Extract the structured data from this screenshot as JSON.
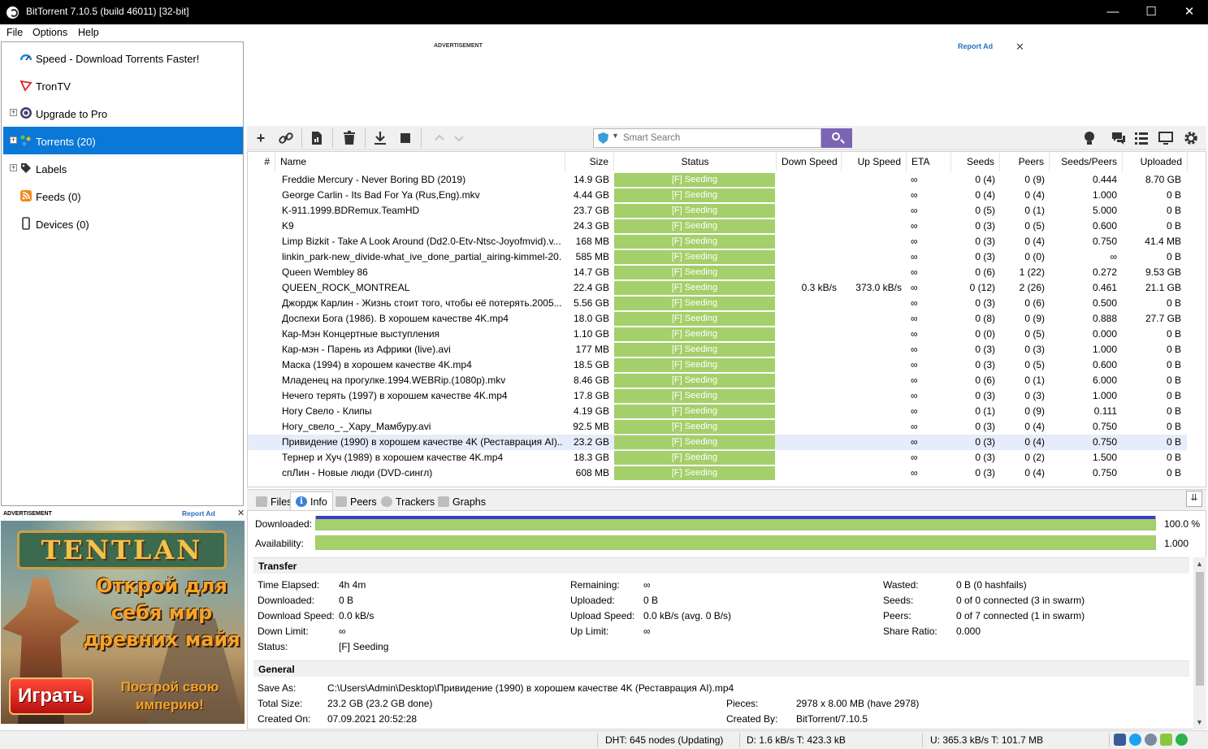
{
  "window": {
    "title": "BitTorrent 7.10.5  (build 46011) [32-bit]",
    "minimize": "—",
    "maximize": "☐",
    "close": "✕"
  },
  "menu": [
    "File",
    "Options",
    "Help"
  ],
  "sidebar": {
    "items": [
      {
        "label": "Speed - Download Torrents Faster!",
        "icon": "speedometer-icon",
        "expander": ""
      },
      {
        "label": "TronTV",
        "icon": "tron-icon",
        "expander": ""
      },
      {
        "label": "Upgrade to Pro",
        "icon": "bittorrent-logo-icon",
        "expander": "+"
      },
      {
        "label": "Torrents (20)",
        "icon": "torrents-icon",
        "expander": "+"
      },
      {
        "label": "Labels",
        "icon": "label-tag-icon",
        "expander": "+"
      },
      {
        "label": "Feeds (0)",
        "icon": "rss-icon",
        "expander": ""
      },
      {
        "label": "Devices (0)",
        "icon": "device-icon",
        "expander": ""
      }
    ]
  },
  "side_ad": {
    "header": "ADVERTISEMENT",
    "report": "Report Ad",
    "close": "✕",
    "logo": "TENTLAN",
    "headline": "Открой для себя мир древних майя",
    "play": "Играть",
    "sub": "Построй свою империю!"
  },
  "top_ad": {
    "header": "ADVERTISEMENT",
    "report": "Report Ad",
    "close": "✕"
  },
  "toolbar": {
    "add": "+",
    "search_placeholder": "Smart Search"
  },
  "table": {
    "columns": [
      "#",
      "Name",
      "Size",
      "Status",
      "Down Speed",
      "Up Speed",
      "ETA",
      "Seeds",
      "Peers",
      "Seeds/Peers",
      "Uploaded"
    ],
    "rows": [
      {
        "name": "Freddie Mercury - Never Boring BD (2019)",
        "size": "14.9 GB",
        "status": "[F] Seeding",
        "down": "",
        "up": "",
        "eta": "∞",
        "seeds": "0 (4)",
        "peers": "0 (9)",
        "ratio": "0.444",
        "uploaded": "8.70 GB"
      },
      {
        "name": "George Carlin - Its Bad For Ya (Rus,Eng).mkv",
        "size": "4.44 GB",
        "status": "[F] Seeding",
        "down": "",
        "up": "",
        "eta": "∞",
        "seeds": "0 (4)",
        "peers": "0 (4)",
        "ratio": "1.000",
        "uploaded": "0 B"
      },
      {
        "name": "K-911.1999.BDRemux.TeamHD",
        "size": "23.7 GB",
        "status": "[F] Seeding",
        "down": "",
        "up": "",
        "eta": "∞",
        "seeds": "0 (5)",
        "peers": "0 (1)",
        "ratio": "5.000",
        "uploaded": "0 B"
      },
      {
        "name": "K9",
        "size": "24.3 GB",
        "status": "[F] Seeding",
        "down": "",
        "up": "",
        "eta": "∞",
        "seeds": "0 (3)",
        "peers": "0 (5)",
        "ratio": "0.600",
        "uploaded": "0 B"
      },
      {
        "name": "Limp Bizkit - Take A Look Around (Dd2.0-Etv-Ntsc-Joyofmvid).v...",
        "size": "168 MB",
        "status": "[F] Seeding",
        "down": "",
        "up": "",
        "eta": "∞",
        "seeds": "0 (3)",
        "peers": "0 (4)",
        "ratio": "0.750",
        "uploaded": "41.4 MB"
      },
      {
        "name": "linkin_park-new_divide-what_ive_done_partial_airing-kimmel-20...",
        "size": "585 MB",
        "status": "[F] Seeding",
        "down": "",
        "up": "",
        "eta": "∞",
        "seeds": "0 (3)",
        "peers": "0 (0)",
        "ratio": "∞",
        "uploaded": "0 B"
      },
      {
        "name": "Queen Wembley 86",
        "size": "14.7 GB",
        "status": "[F] Seeding",
        "down": "",
        "up": "",
        "eta": "∞",
        "seeds": "0 (6)",
        "peers": "1 (22)",
        "ratio": "0.272",
        "uploaded": "9.53 GB"
      },
      {
        "name": "QUEEN_ROCK_MONTREAL",
        "size": "22.4 GB",
        "status": "[F] Seeding",
        "down": "0.3 kB/s",
        "up": "373.0 kB/s",
        "eta": "∞",
        "seeds": "0 (12)",
        "peers": "2 (26)",
        "ratio": "0.461",
        "uploaded": "21.1 GB"
      },
      {
        "name": "Джордж Карлин - Жизнь стоит того, чтобы её потерять.2005....",
        "size": "5.56 GB",
        "status": "[F] Seeding",
        "down": "",
        "up": "",
        "eta": "∞",
        "seeds": "0 (3)",
        "peers": "0 (6)",
        "ratio": "0.500",
        "uploaded": "0 B"
      },
      {
        "name": "Доспехи Бога (1986). В хорошем качестве 4K.mp4",
        "size": "18.0 GB",
        "status": "[F] Seeding",
        "down": "",
        "up": "",
        "eta": "∞",
        "seeds": "0 (8)",
        "peers": "0 (9)",
        "ratio": "0.888",
        "uploaded": "27.7 GB"
      },
      {
        "name": "Кар-Мэн Концертные выступления",
        "size": "1.10 GB",
        "status": "[F] Seeding",
        "down": "",
        "up": "",
        "eta": "∞",
        "seeds": "0 (0)",
        "peers": "0 (5)",
        "ratio": "0.000",
        "uploaded": "0 B"
      },
      {
        "name": "Кар-мэн - Парень из Африки (live).avi",
        "size": "177 MB",
        "status": "[F] Seeding",
        "down": "",
        "up": "",
        "eta": "∞",
        "seeds": "0 (3)",
        "peers": "0 (3)",
        "ratio": "1.000",
        "uploaded": "0 B"
      },
      {
        "name": "Маска (1994) в хорошем качестве 4K.mp4",
        "size": "18.5 GB",
        "status": "[F] Seeding",
        "down": "",
        "up": "",
        "eta": "∞",
        "seeds": "0 (3)",
        "peers": "0 (5)",
        "ratio": "0.600",
        "uploaded": "0 B"
      },
      {
        "name": "Младенец на прогулке.1994.WEBRip.(1080p).mkv",
        "size": "8.46 GB",
        "status": "[F] Seeding",
        "down": "",
        "up": "",
        "eta": "∞",
        "seeds": "0 (6)",
        "peers": "0 (1)",
        "ratio": "6.000",
        "uploaded": "0 B"
      },
      {
        "name": "Нечего терять (1997) в хорошем качестве 4K.mp4",
        "size": "17.8 GB",
        "status": "[F] Seeding",
        "down": "",
        "up": "",
        "eta": "∞",
        "seeds": "0 (3)",
        "peers": "0 (3)",
        "ratio": "1.000",
        "uploaded": "0 B"
      },
      {
        "name": "Ногу Свело - Клипы",
        "size": "4.19 GB",
        "status": "[F] Seeding",
        "down": "",
        "up": "",
        "eta": "∞",
        "seeds": "0 (1)",
        "peers": "0 (9)",
        "ratio": "0.111",
        "uploaded": "0 B"
      },
      {
        "name": "Ногу_свело_-_Хару_Мамбуру.avi",
        "size": "92.5 MB",
        "status": "[F] Seeding",
        "down": "",
        "up": "",
        "eta": "∞",
        "seeds": "0 (3)",
        "peers": "0 (4)",
        "ratio": "0.750",
        "uploaded": "0 B"
      },
      {
        "name": "Привидение (1990) в хорошем качестве 4K (Реставрация AI)....",
        "size": "23.2 GB",
        "status": "[F] Seeding",
        "down": "",
        "up": "",
        "eta": "∞",
        "seeds": "0 (3)",
        "peers": "0 (4)",
        "ratio": "0.750",
        "uploaded": "0 B",
        "selected": true
      },
      {
        "name": "Тернер и Хуч (1989) в хорошем качестве 4K.mp4",
        "size": "18.3 GB",
        "status": "[F] Seeding",
        "down": "",
        "up": "",
        "eta": "∞",
        "seeds": "0 (3)",
        "peers": "0 (2)",
        "ratio": "1.500",
        "uploaded": "0 B"
      },
      {
        "name": "спЛин - Новые люди (DVD-сингл)",
        "size": "608 MB",
        "status": "[F] Seeding",
        "down": "",
        "up": "",
        "eta": "∞",
        "seeds": "0 (3)",
        "peers": "0 (4)",
        "ratio": "0.750",
        "uploaded": "0 B"
      }
    ]
  },
  "tabs": [
    "Files",
    "Info",
    "Peers",
    "Trackers",
    "Graphs"
  ],
  "collapse": "⇊",
  "info": {
    "downloaded_label": "Downloaded:",
    "downloaded_value": "100.0 %",
    "downloaded_fraction": 1.0,
    "availability_label": "Availability:",
    "availability_value": "1.000",
    "transfer": {
      "title": "Transfer",
      "col1": [
        {
          "k": "Time Elapsed:",
          "v": "4h 4m"
        },
        {
          "k": "Downloaded:",
          "v": "0 B"
        },
        {
          "k": "Download Speed:",
          "v": "0.0 kB/s"
        },
        {
          "k": "Down Limit:",
          "v": "∞"
        },
        {
          "k": "Status:",
          "v": "[F] Seeding"
        }
      ],
      "col2": [
        {
          "k": "Remaining:",
          "v": "∞"
        },
        {
          "k": "Uploaded:",
          "v": "0 B"
        },
        {
          "k": "Upload Speed:",
          "v": "0.0 kB/s (avg. 0 B/s)"
        },
        {
          "k": "Up Limit:",
          "v": "∞"
        }
      ],
      "col3": [
        {
          "k": "Wasted:",
          "v": "0 B (0 hashfails)"
        },
        {
          "k": "Seeds:",
          "v": "0 of 0 connected (3 in swarm)"
        },
        {
          "k": "Peers:",
          "v": "0 of 7 connected (1 in swarm)"
        },
        {
          "k": "Share Ratio:",
          "v": "0.000"
        }
      ]
    },
    "general": {
      "title": "General",
      "save_as_k": "Save As:",
      "save_as_v": "C:\\Users\\Admin\\Desktop\\Привидение (1990) в хорошем качестве 4K (Реставрация AI).mp4",
      "total_size_k": "Total Size:",
      "total_size_v": "23.2 GB (23.2 GB done)",
      "created_on_k": "Created On:",
      "created_on_v": "07.09.2021 20:52:28",
      "pieces_k": "Pieces:",
      "pieces_v": "2978 x 8.00 MB (have 2978)",
      "created_by_k": "Created By:",
      "created_by_v": "BitTorrent/7.10.5"
    }
  },
  "statusbar": {
    "dht": "DHT: 645 nodes (Updating)",
    "down": "D: 1.6 kB/s T: 423.3 kB",
    "up": "U: 365.3 kB/s T: 101.7 MB"
  },
  "colors": {
    "accent_selected": "#0a78d7",
    "status_seeding": "#a5cf6a",
    "search_button": "#7b64b6"
  }
}
